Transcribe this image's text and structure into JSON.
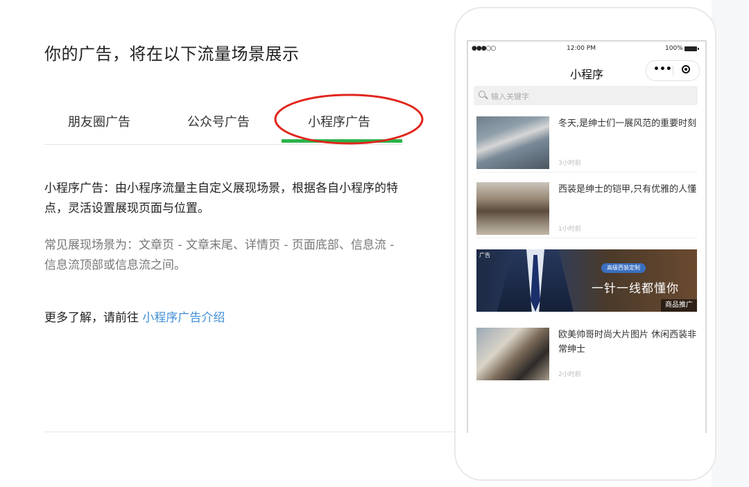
{
  "page": {
    "title": "你的广告，将在以下流量场景展示"
  },
  "tabs": [
    {
      "label": "朋友圈广告",
      "selected": false
    },
    {
      "label": "公众号广告",
      "selected": false
    },
    {
      "label": "小程序广告",
      "selected": true
    }
  ],
  "accent_colors": {
    "tab_underline": "#2bb34a",
    "annotation_circle": "#e0261c",
    "link": "#3e8ed6"
  },
  "description": {
    "main": "小程序广告：由小程序流量主自定义展现场景，根据各自小程序的特点，灵活设置展现页面与位置。",
    "sub": "常见展现场景为：文章页 - 文章末尾、详情页 - 页面底部、信息流 - 信息流顶部或信息流之间。",
    "more_prefix": "更多了解，请前往 ",
    "more_link": "小程序广告介绍"
  },
  "phone": {
    "status": {
      "signal": "●●●○○",
      "time": "12:00 PM",
      "battery": "100%"
    },
    "nav_title": "小程序",
    "capsule_icons": [
      "more-dots-icon",
      "close-target-icon"
    ],
    "search_placeholder": "输入关键字",
    "articles": [
      {
        "title": "冬天,是绅士们一展风范的重要时刻",
        "time": "3小时前"
      },
      {
        "title": "西装是绅士的铠甲,只有优雅的人懂",
        "time": "1小时前"
      },
      {
        "title": "欧美帅哥时尚大片图片 休闲西装非常绅士",
        "time": "2小时前"
      }
    ],
    "ad": {
      "label": "广告",
      "pill": "高级西装定制",
      "tagline": "一针一线都懂你",
      "corner": "商品推广"
    }
  }
}
